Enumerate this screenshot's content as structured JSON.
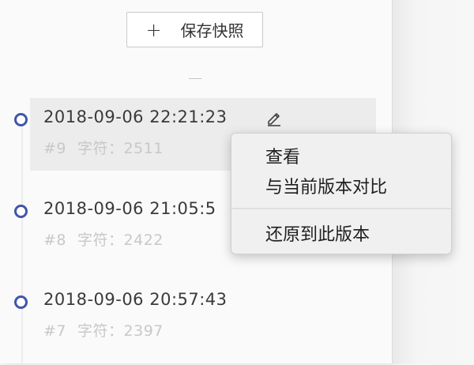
{
  "toolbar": {
    "save_snapshot_label": "保存快照",
    "plus_glyph": "+"
  },
  "history": [
    {
      "timestamp": "2018-09-06 22:21:23",
      "number": "#9",
      "chars_label": "字符：2511",
      "active": true
    },
    {
      "timestamp": "2018-09-06 21:05:5",
      "number": "#8",
      "chars_label": "字符：2422",
      "active": false
    },
    {
      "timestamp": "2018-09-06 20:57:43",
      "number": "#7",
      "chars_label": "字符：2397",
      "active": false
    }
  ],
  "context_menu": {
    "view": "查看",
    "compare": "与当前版本对比",
    "restore": "还原到此版本"
  },
  "colors": {
    "timeline_dot": "#3f56a8",
    "active_row_bg": "#ececec",
    "meta_text": "#c8c8c8"
  },
  "icons": {
    "edit": "pencil-icon"
  }
}
